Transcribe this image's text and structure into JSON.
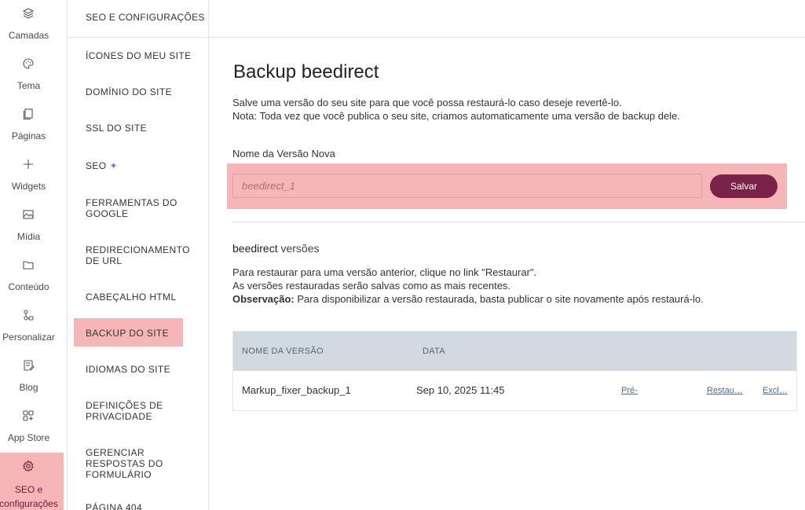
{
  "rail": {
    "items": [
      {
        "label": "Camadas",
        "icon": "layers-icon"
      },
      {
        "label": "Tema",
        "icon": "palette-icon"
      },
      {
        "label": "Páginas",
        "icon": "pages-icon"
      },
      {
        "label": "Widgets",
        "icon": "plus-icon"
      },
      {
        "label": "Mídia",
        "icon": "image-icon"
      },
      {
        "label": "Conteúdo",
        "icon": "folder-icon"
      },
      {
        "label": "Personalizar",
        "icon": "customize-icon"
      },
      {
        "label": "Blog",
        "icon": "blog-icon"
      },
      {
        "label": "App Store",
        "icon": "app-store-icon"
      },
      {
        "label": "SEO e configurações",
        "icon": "gear-icon"
      }
    ]
  },
  "nav": {
    "header": "SEO E CONFIGURAÇÕES",
    "items": [
      "ÍCONES DO MEU SITE",
      "DOMÍNIO DO SITE",
      "SSL DO SITE",
      "SEO",
      "FERRAMENTAS DO GOOGLE",
      "REDIRECIONAMENTO DE URL",
      "CABEÇALHO HTML",
      "BACKUP DO SITE",
      "IDIOMAS DO SITE",
      "DEFINIÇÕES DE PRIVACIDADE",
      "GERENCIAR RESPOSTAS DO FORMULÁRIO",
      "PÁGINA 404"
    ],
    "active": "BACKUP DO SITE"
  },
  "main": {
    "title": "Backup beedirect",
    "desc_line1": "Salve uma versão do seu site para que você possa restaurá-lo caso deseje revertê-lo.",
    "desc_line2": "Nota: Toda vez que você publica o seu site, criamos automaticamente uma versão de backup dele.",
    "field_label": "Nome da Versão Nova",
    "input_placeholder": "beedirect_1",
    "save_label": "Salvar",
    "versions_title_brand": "beedirect",
    "versions_title_rest": " versões",
    "versions_desc_line1": "Para restaurar para uma versão anterior, clique no link \"Restaurar\".",
    "versions_desc_line2": "As versões restauradas serão salvas como as mais recentes.",
    "versions_desc_bold": "Observação:",
    "versions_desc_line3": " Para disponibilizar a versão restaurada, basta publicar o site novamente após restaurá-lo.",
    "table": {
      "headers": [
        "NOME DA VERSÃO",
        "DATA"
      ],
      "rows": [
        {
          "name": "Markup_fixer_backup_1",
          "date": "Sep 10, 2025 11:45",
          "preview": "Pré-",
          "restore": "Restau…",
          "delete": "Excl…"
        }
      ]
    }
  },
  "colors": {
    "accent": "#7a2349",
    "highlight": "#f6b6b8",
    "table_header": "#d1dae1"
  }
}
